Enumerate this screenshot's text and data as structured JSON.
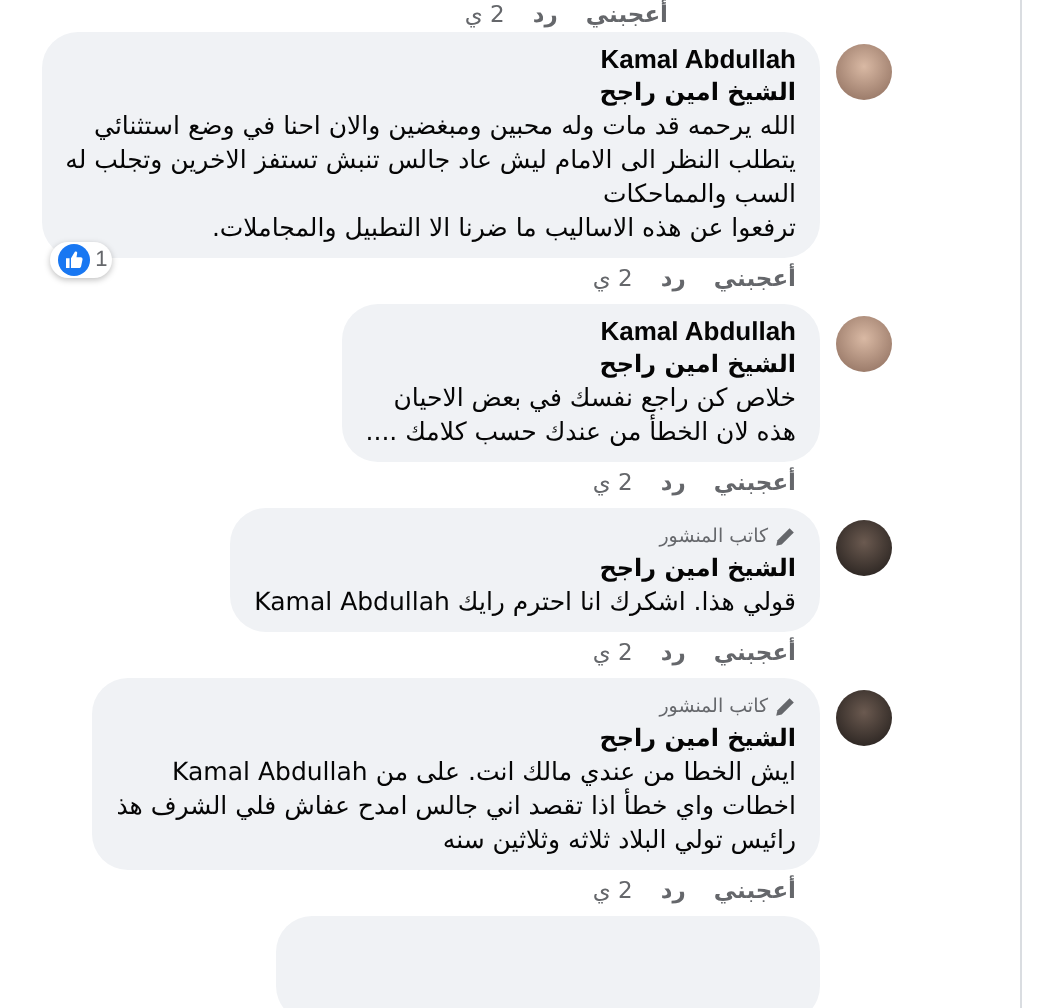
{
  "top_actions": {
    "like": "أعجبني",
    "reply": "رد",
    "time": "2 ي"
  },
  "comments": [
    {
      "kind": "comment",
      "author": "Kamal Abdullah",
      "mention": "الشيخ امين راجح",
      "lines": [
        "الله يرحمه قد مات وله محبين ومبغضين والان احنا في وضع استثنائي",
        "يتطلب النظر الى الامام ليش عاد جالس تنبش تستفز الاخرين وتجلب له",
        "السب والمماحكات",
        "ترفعوا عن هذه الاساليب ما ضرنا الا التطبيل والمجاملات."
      ],
      "reactions": "1",
      "actions": {
        "like": "أعجبني",
        "reply": "رد",
        "time": "2 ي"
      }
    },
    {
      "kind": "comment",
      "author": "Kamal Abdullah",
      "mention": "الشيخ امين راجح",
      "lines": [
        "خلاص كن راجع نفسك في بعض الاحيان",
        "هذه لان الخطأ من عندك حسب كلامك ...."
      ],
      "actions": {
        "like": "أعجبني",
        "reply": "رد",
        "time": "2 ي"
      }
    },
    {
      "kind": "comment",
      "badge": "كاتب المنشور",
      "author": "الشيخ امين راجح",
      "lines": [
        "قولي هذا. اشكرك انا احترم رايك Kamal Abdullah"
      ],
      "actions": {
        "like": "أعجبني",
        "reply": "رد",
        "time": "2 ي"
      }
    },
    {
      "kind": "comment",
      "badge": "كاتب المنشور",
      "author": "الشيخ امين راجح",
      "lines": [
        "ايش الخطا من عندي مالك انت. على من Kamal Abdullah",
        "اخطات واي خطأ اذا تقصد اني جالس امدح عفاش فلي الشرف هذ",
        "رائيس تولي البلاد ثلاثه وثلاثين سنه"
      ],
      "actions": {
        "like": "أعجبني",
        "reply": "رد",
        "time": "2 ي"
      }
    },
    {
      "kind": "partial"
    }
  ]
}
